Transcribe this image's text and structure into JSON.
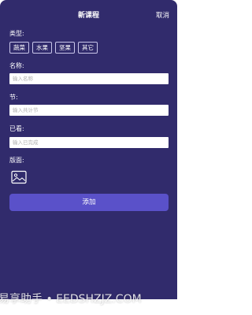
{
  "header": {
    "title": "新课程",
    "cancel_label": "取消"
  },
  "form": {
    "type_label": "类型:",
    "categories": [
      "蔬菜",
      "水果",
      "坚果",
      "其它"
    ],
    "name": {
      "label": "名称:",
      "placeholder": "输入名称"
    },
    "sections": {
      "label": "节:",
      "placeholder": "输入共计节"
    },
    "watched": {
      "label": "已看:",
      "placeholder": "输入已完成"
    },
    "cover": {
      "label": "版面:",
      "icon": "image-icon"
    },
    "submit_label": "添加"
  },
  "watermark": {
    "text": "易享助手 • EEDSHZJZ.COM"
  },
  "colors": {
    "background": "#312b6c",
    "accent_button": "#5a51c9",
    "field": "#ffffff",
    "text": "#ffffff"
  }
}
